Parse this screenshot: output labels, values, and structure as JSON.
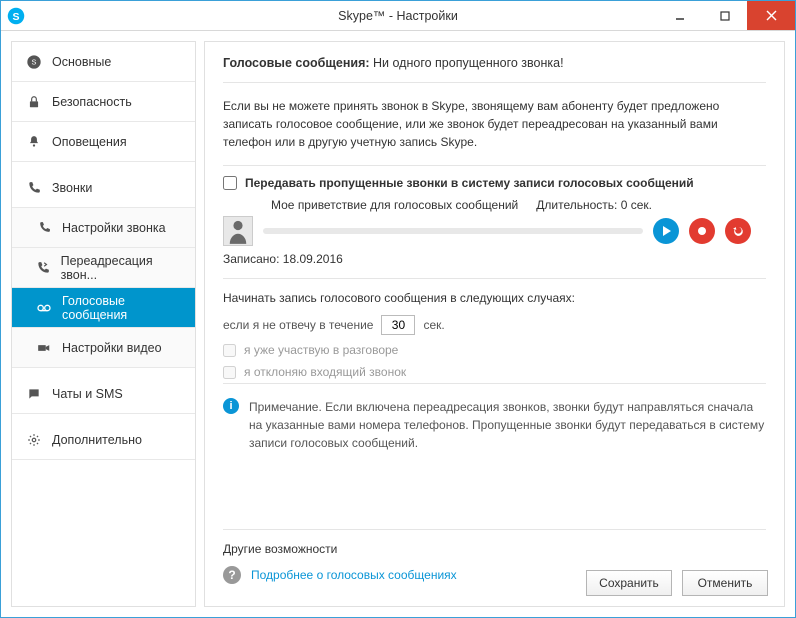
{
  "window": {
    "title": "Skype™ - Настройки"
  },
  "sidebar": {
    "items": [
      {
        "label": "Основные"
      },
      {
        "label": "Безопасность"
      },
      {
        "label": "Оповещения"
      },
      {
        "label": "Звонки"
      },
      {
        "label": "Настройки звонка"
      },
      {
        "label": "Переадресация звон..."
      },
      {
        "label": "Голосовые сообщения"
      },
      {
        "label": "Настройки видео"
      },
      {
        "label": "Чаты и SMS"
      },
      {
        "label": "Дополнительно"
      }
    ]
  },
  "header": {
    "prefix": "Голосовые сообщения:",
    "suffix": " Ни одного пропущенного звонка!"
  },
  "intro": "Если вы не можете принять звонок в Skype, звонящему вам абоненту будет предложено записать голосовое сообщение, или же звонок будет переадресован на указанный вами телефон или в другую учетную запись Skype.",
  "forward_check_label": "Передавать пропущенные звонки в систему записи голосовых сообщений",
  "greeting": {
    "label1": "Мое приветствие для голосовых сообщений",
    "label2": "Длительность: 0 сек."
  },
  "recorded": "Записано: 18.09.2016",
  "start_rec_label": "Начинать запись голосового сообщения в следующих случаях:",
  "cond1_prefix": "если я не отвечу в течение ",
  "cond1_value": "30",
  "cond1_suffix": " сек.",
  "cond2": "я уже участвую в разговоре",
  "cond3": "я отклоняю входящий звонок",
  "note": "Примечание. Если включена переадресация звонков, звонки будут направляться сначала на указанные вами номера телефонов. Пропущенные звонки будут передаваться в систему записи голосовых сообщений.",
  "other": {
    "label": "Другие возможности",
    "link": "Подробнее о голосовых сообщениях"
  },
  "buttons": {
    "save": "Сохранить",
    "cancel": "Отменить"
  }
}
